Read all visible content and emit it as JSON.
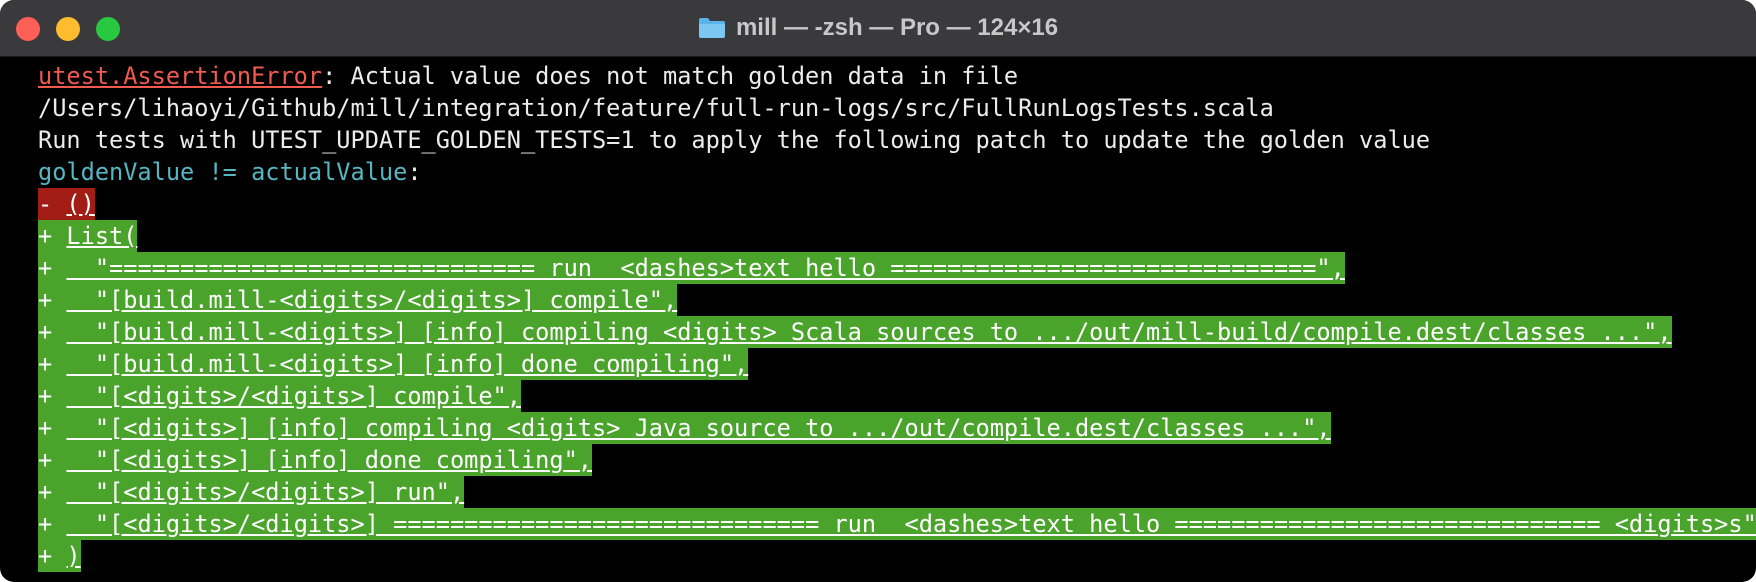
{
  "window": {
    "title": "mill — -zsh — Pro — 124×16",
    "folder_icon": "folder-icon"
  },
  "terminal": {
    "error_line": {
      "type": "utest.AssertionError",
      "message": ": Actual value does not match golden data in file"
    },
    "file_path": "/Users/lihaoyi/Github/mill/integration/feature/full-run-logs/src/FullRunLogsTests.scala",
    "instruction": "Run tests with UTEST_UPDATE_GOLDEN_TESTS=1 to apply the following patch to update the golden value",
    "comparison": {
      "expr": "goldenValue != actualValue",
      "colon": ":"
    },
    "removed": {
      "prefix": "- ",
      "text": "()"
    },
    "added": [
      {
        "prefix": "+ ",
        "text": "List("
      },
      {
        "prefix": "+ ",
        "text": "  \"============================== run  <dashes>text hello ==============================\","
      },
      {
        "prefix": "+ ",
        "text": "  \"[build.mill-<digits>/<digits>] compile\","
      },
      {
        "prefix": "+ ",
        "text": "  \"[build.mill-<digits>] [info] compiling <digits> Scala sources to .../out/mill-build/compile.dest/classes ...\","
      },
      {
        "prefix": "+ ",
        "text": "  \"[build.mill-<digits>] [info] done compiling\","
      },
      {
        "prefix": "+ ",
        "text": "  \"[<digits>/<digits>] compile\","
      },
      {
        "prefix": "+ ",
        "text": "  \"[<digits>] [info] compiling <digits> Java source to .../out/compile.dest/classes ...\","
      },
      {
        "prefix": "+ ",
        "text": "  \"[<digits>] [info] done compiling\","
      },
      {
        "prefix": "+ ",
        "text": "  \"[<digits>/<digits>] run\","
      },
      {
        "prefix": "+ ",
        "text": "  \"[<digits>/<digits>] ============================== run  <dashes>text hello ============================== <digits>s\""
      },
      {
        "prefix": "+ ",
        "text": ")"
      }
    ]
  },
  "colors": {
    "error": "#f05a4f",
    "cyan": "#56b6c2",
    "diff_removed_bg": "#a11d16",
    "diff_added_bg": "#4aa32b",
    "background": "#000000"
  }
}
